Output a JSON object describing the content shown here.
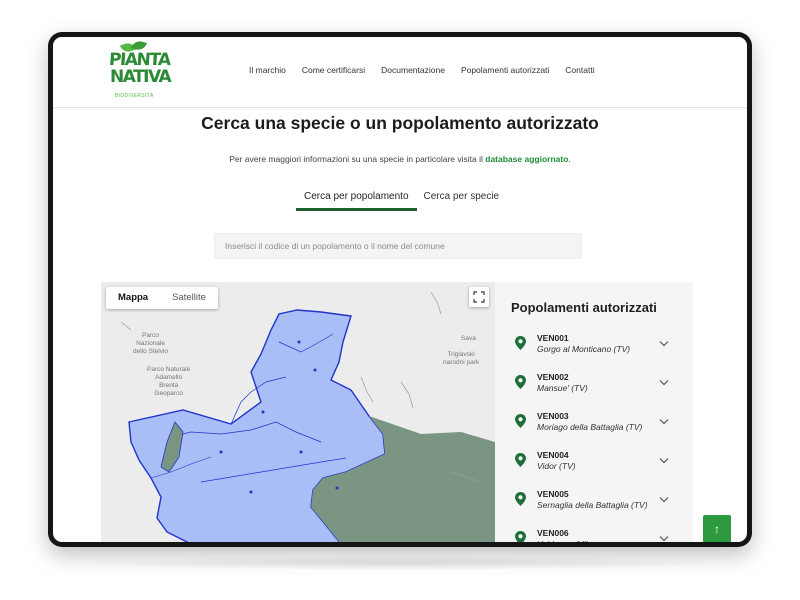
{
  "logo": {
    "line1": "PIANTA",
    "line2": "NATIVA",
    "tagline": "BIODIVERSITÀ"
  },
  "nav": {
    "items": [
      "Il marchio",
      "Come certificarsi",
      "Documentazione",
      "Popolamenti autorizzati",
      "Contatti"
    ]
  },
  "main": {
    "title": "Cerca una specie o un popolamento autorizzato",
    "info_text": "Per avere maggiori informazioni su una specie in particolare visita il ",
    "info_link": "database aggiornato",
    "info_end": ".",
    "tabs": [
      {
        "label": "Cerca per popolamento",
        "active": true
      },
      {
        "label": "Cerca per specie",
        "active": false
      }
    ],
    "search": {
      "placeholder": "Inserisci il codice di un popolamento o il nome del comune",
      "value": ""
    }
  },
  "map": {
    "toggle": {
      "map_label": "Mappa",
      "satellite_label": "Satellite",
      "selected": "Mappa"
    },
    "fullscreen_icon": "fullscreen-icon",
    "labels": [
      "Parco\nNazionale\ndello Stelvio",
      "Parco Naturale\nAdamello\nBrenta\nGeoparco",
      "Triglavski\nnarodni park",
      "Sava"
    ],
    "region_fill": "#a9bdf6",
    "region_stroke": "#1f35c9",
    "sea_color": "#7a9682"
  },
  "panel": {
    "title": "Popolamenti autorizzati",
    "items": [
      {
        "code": "VEN001",
        "name": "Gorgo al Monticano (TV)"
      },
      {
        "code": "VEN002",
        "name": "Mansue' (TV)"
      },
      {
        "code": "VEN003",
        "name": "Moriago della Battaglia (TV)"
      },
      {
        "code": "VEN004",
        "name": "Vidor (TV)"
      },
      {
        "code": "VEN005",
        "name": "Sernaglia della Battaglia (TV)"
      },
      {
        "code": "VEN006",
        "name": "Valdagno (VI)"
      }
    ]
  },
  "scroll_top": {
    "icon": "arrow-up-icon",
    "symbol": "↑"
  },
  "colors": {
    "brand_green": "#1e8c3a",
    "tab_underline": "#1e5e2c",
    "button_green": "#2e9a3f",
    "pin_green": "#1e6e3a"
  }
}
